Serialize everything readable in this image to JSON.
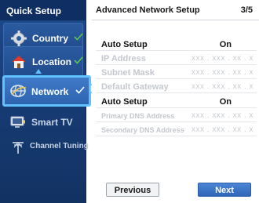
{
  "sidebar": {
    "title": "Quick Setup",
    "items": [
      {
        "label": "Country",
        "icon": "gear-icon",
        "completed": true
      },
      {
        "label": "Location",
        "icon": "home-icon",
        "completed": true
      },
      {
        "label": "Network",
        "icon": "network-globe-icon",
        "completed": true,
        "selected": true
      },
      {
        "label": "Smart TV",
        "icon": "smart-tv-icon",
        "completed": false
      },
      {
        "label": "Channel Tuning",
        "icon": "antenna-icon",
        "completed": false
      }
    ]
  },
  "main": {
    "title": "Advanced Network Setup",
    "page_counter": "3/5",
    "rows": [
      {
        "label": "Auto Setup",
        "value": "On",
        "enabled": true
      },
      {
        "label": "IP Address",
        "value": "xxx . xxx . xx . x",
        "enabled": false
      },
      {
        "label": "Subnet Mask",
        "value": "xxx . xxx . xx . x",
        "enabled": false
      },
      {
        "label": "Default Gateway",
        "value": "xxx . xxx . xx . x",
        "enabled": false
      },
      {
        "label": "Auto Setup",
        "value": "On",
        "enabled": true
      },
      {
        "label": "Primary DNS Address",
        "value": "xxx . xxx . xx . x",
        "enabled": false
      },
      {
        "label": "Secondary DNS Address",
        "value": "xxx . xxx . xx . x",
        "enabled": false
      }
    ],
    "buttons": {
      "previous": "Previous",
      "next": "Next"
    }
  },
  "colors": {
    "sidebar_bg": "#1e4a8c",
    "selected_border": "#5fc2ff",
    "check": "#5cc94a",
    "next_button": "#2f66b8"
  }
}
